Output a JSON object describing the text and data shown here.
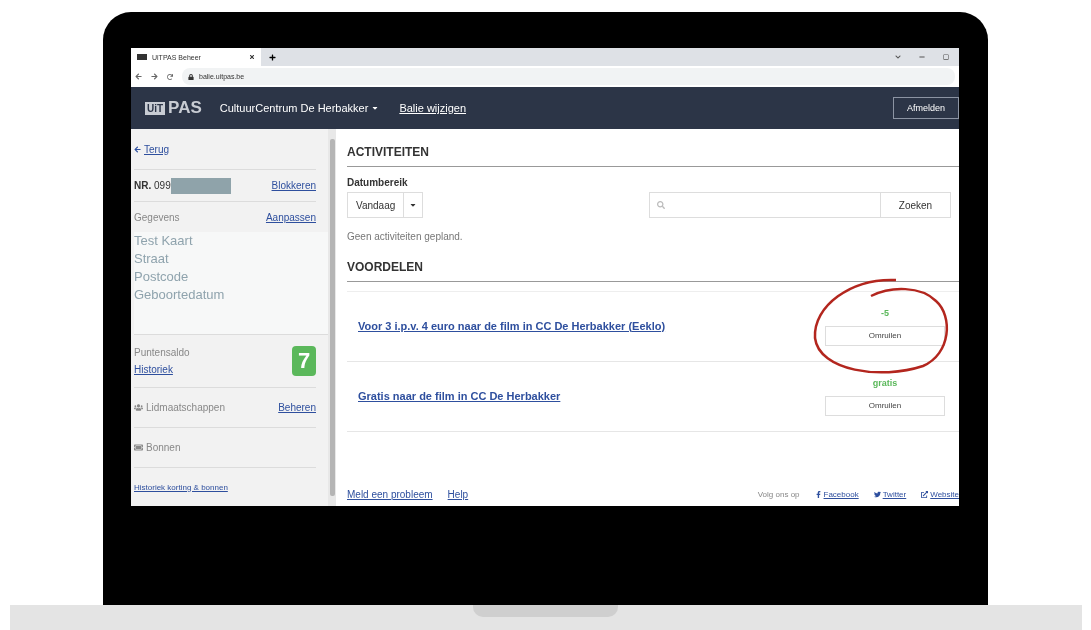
{
  "browser": {
    "tab_title": "UiTPAS Beheer",
    "url": "balie.uitpas.be"
  },
  "navbar": {
    "logo": [
      "UiT",
      "PAS"
    ],
    "organisation": "CultuurCentrum De Herbakker",
    "change_link": "Balie wijzigen",
    "logout": "Afmelden"
  },
  "sidebar": {
    "back": "Terug",
    "card_number_label": "NR.",
    "card_number": "099",
    "block_link": "Blokkeren",
    "details_label": "Gegevens",
    "edit_link": "Aanpassen",
    "details": [
      "Test Kaart",
      "Straat",
      "Postcode",
      "Geboortedatum"
    ],
    "points_label": "Puntensaldo",
    "points": "7",
    "history_link": "Historiek",
    "memberships_label": "Lidmaatschappen",
    "manage_link": "Beheren",
    "vouchers_label": "Bonnen",
    "footer_link": "Historiek korting & bonnen"
  },
  "activities": {
    "title": "ACTIVITEITEN",
    "date_label": "Datumbereik",
    "date_value": "Vandaag",
    "search_button": "Zoeken",
    "empty": "Geen activiteiten gepland."
  },
  "benefits": {
    "title": "VOORDELEN",
    "items": [
      {
        "title": "Voor 3 i.p.v. 4 euro naar de film in CC De Herbakker (Eeklo)",
        "points": "-5",
        "button": "Omruilen",
        "highlighted": true
      },
      {
        "title": "Gratis naar de film in CC De Herbakker",
        "points": "gratis",
        "button": "Omruilen",
        "highlighted": false
      }
    ]
  },
  "footer": {
    "links": [
      "Meld een probleem",
      "Help"
    ],
    "follow_label": "Volg ons op",
    "social": [
      {
        "kind": "facebook",
        "label": "Facebook"
      },
      {
        "kind": "twitter",
        "label": "Twitter"
      },
      {
        "kind": "website",
        "label": "Website"
      }
    ]
  }
}
